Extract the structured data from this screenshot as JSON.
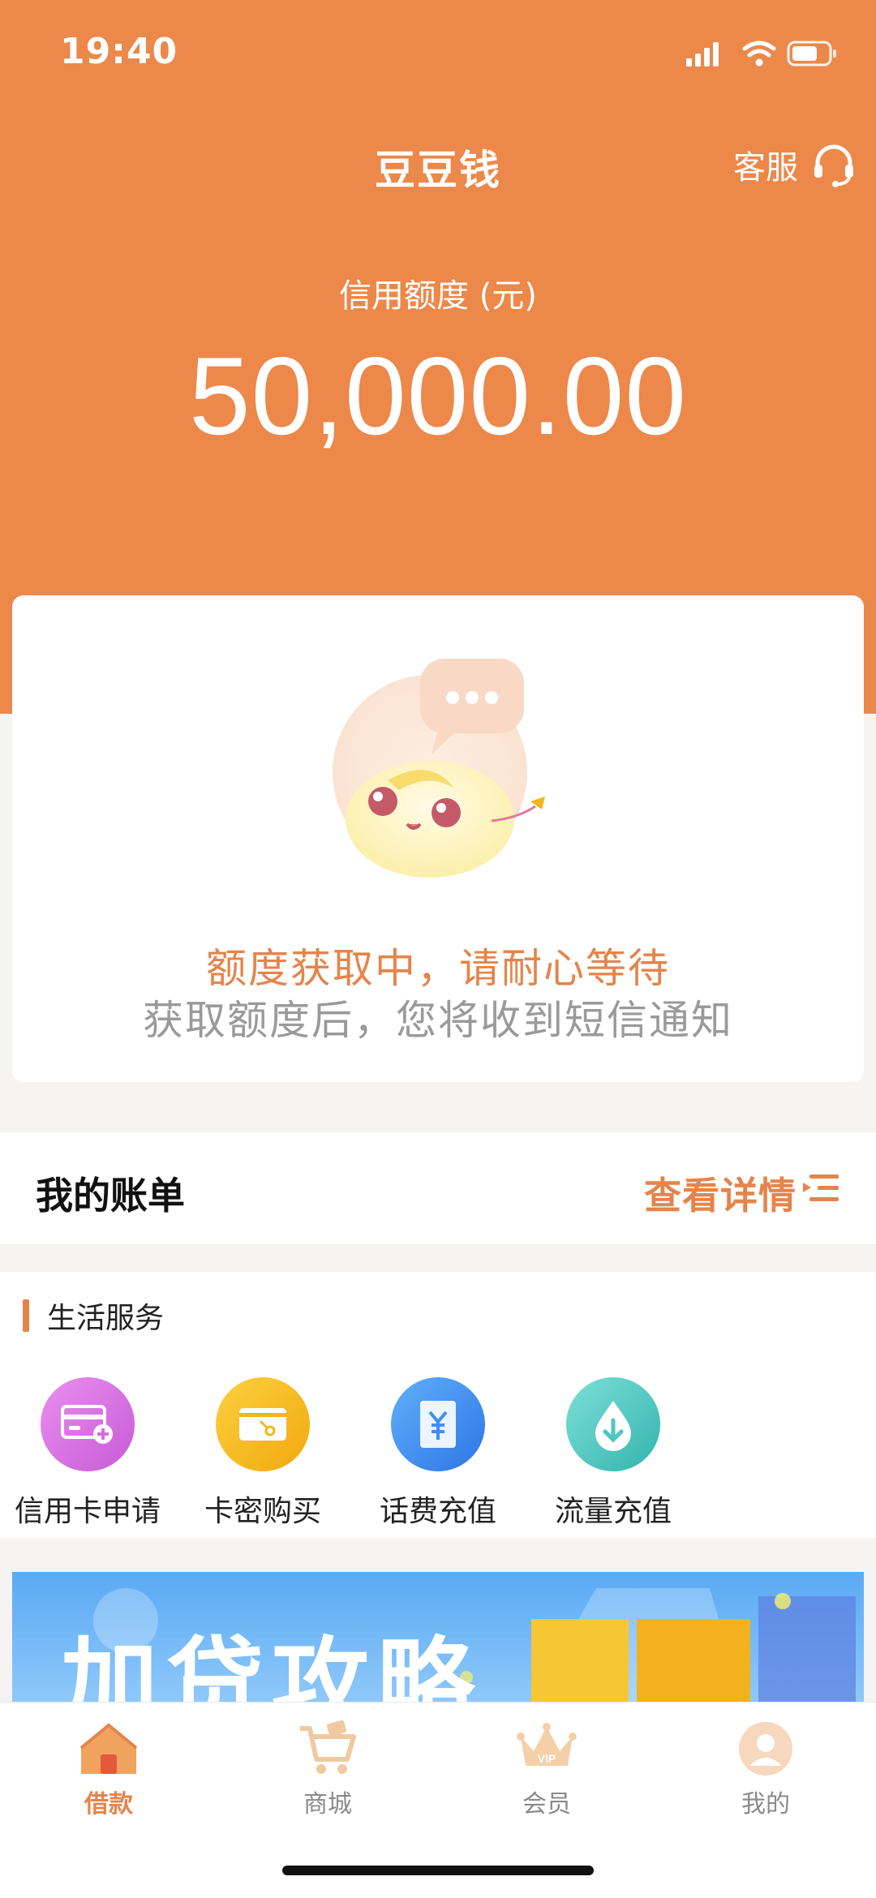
{
  "status_bar": {
    "time": "19:40"
  },
  "header": {
    "app_title": "豆豆钱",
    "service_label": "客服",
    "credit_label": "信用额度 (元)",
    "credit_amount": "50,000.00",
    "accent_color": "#ec884a"
  },
  "status_card": {
    "main_text": "额度获取中，请耐心等待",
    "sub_text": "获取额度后，您将收到短信通知"
  },
  "bill": {
    "title": "我的账单",
    "detail_label": "查看详情"
  },
  "life_services": {
    "title": "生活服务",
    "items": [
      {
        "label": "信用卡申请",
        "icon": "credit-card-icon",
        "color": "#d76ee0"
      },
      {
        "label": "卡密购买",
        "icon": "card-key-icon",
        "color": "#f5b716"
      },
      {
        "label": "话费充值",
        "icon": "yuan-icon",
        "color": "#3f8ff0"
      },
      {
        "label": "流量充值",
        "icon": "data-drop-icon",
        "color": "#4dc7c2"
      }
    ]
  },
  "banner": {
    "text": "加贷攻略"
  },
  "tabbar": {
    "items": [
      {
        "label": "借款",
        "icon": "home-icon",
        "active": true
      },
      {
        "label": "商城",
        "icon": "cart-icon",
        "active": false
      },
      {
        "label": "会员",
        "icon": "crown-vip-icon",
        "active": false
      },
      {
        "label": "我的",
        "icon": "user-icon",
        "active": false
      }
    ]
  }
}
